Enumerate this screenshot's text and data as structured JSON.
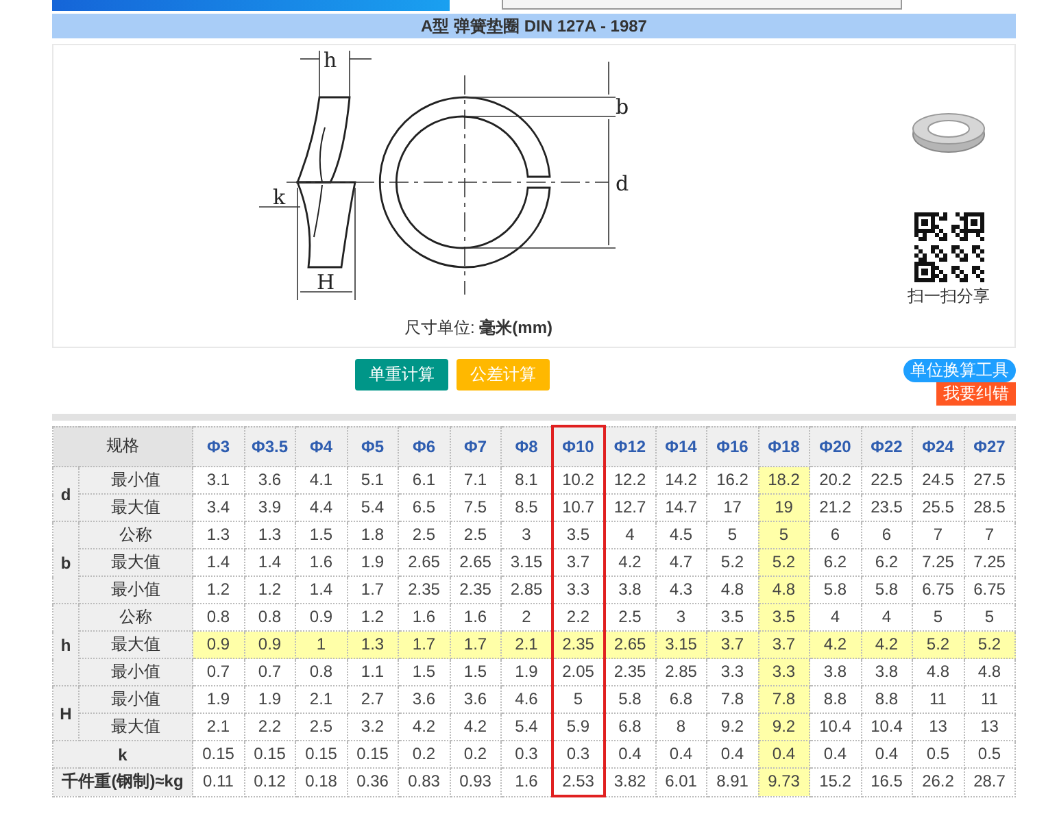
{
  "title": "A型 弹簧垫圈 DIN 127A - 1987",
  "drawing": {
    "labels": {
      "h": "h",
      "k": "k",
      "H": "H",
      "b": "b",
      "d": "d"
    },
    "unit_note": "尺寸单位: **毫米(mm)**",
    "share_label": "扫一扫分享"
  },
  "actions": [
    {
      "label": "单重计算",
      "color": "#009688"
    },
    {
      "label": "公差计算",
      "color": "#ffb800"
    }
  ],
  "side_actions": [
    {
      "label": "单位换算工具",
      "kind": "pill",
      "color": "#1e9fff"
    },
    {
      "label": "我要纠错",
      "kind": "tag",
      "color": "#ff5722"
    }
  ],
  "table": {
    "header_label": "规格",
    "columns": [
      {
        "label": "Φ3",
        "selected": false,
        "highlighted": false
      },
      {
        "label": "Φ3.5",
        "selected": false,
        "highlighted": false
      },
      {
        "label": "Φ4",
        "selected": false,
        "highlighted": false
      },
      {
        "label": "Φ5",
        "selected": false,
        "highlighted": false
      },
      {
        "label": "Φ6",
        "selected": false,
        "highlighted": false
      },
      {
        "label": "Φ7",
        "selected": false,
        "highlighted": false
      },
      {
        "label": "Φ8",
        "selected": false,
        "highlighted": false
      },
      {
        "label": "Φ10",
        "selected": true,
        "highlighted": false
      },
      {
        "label": "Φ12",
        "selected": false,
        "highlighted": false
      },
      {
        "label": "Φ14",
        "selected": false,
        "highlighted": false
      },
      {
        "label": "Φ16",
        "selected": false,
        "highlighted": false
      },
      {
        "label": "Φ18",
        "selected": false,
        "highlighted": true
      },
      {
        "label": "Φ20",
        "selected": false,
        "highlighted": false
      },
      {
        "label": "Φ22",
        "selected": false,
        "highlighted": false
      },
      {
        "label": "Φ24",
        "selected": false,
        "highlighted": false
      },
      {
        "label": "Φ27",
        "selected": false,
        "highlighted": false
      }
    ],
    "groups": [
      {
        "label": "d",
        "kind": "split",
        "rows": [
          {
            "label": "最小值",
            "highlighted": false,
            "values": [
              "3.1",
              "3.6",
              "4.1",
              "5.1",
              "6.1",
              "7.1",
              "8.1",
              "10.2",
              "12.2",
              "14.2",
              "16.2",
              "18.2",
              "20.2",
              "22.5",
              "24.5",
              "27.5"
            ]
          },
          {
            "label": "最大值",
            "highlighted": false,
            "values": [
              "3.4",
              "3.9",
              "4.4",
              "5.4",
              "6.5",
              "7.5",
              "8.5",
              "10.7",
              "12.7",
              "14.7",
              "17",
              "19",
              "21.2",
              "23.5",
              "25.5",
              "28.5"
            ]
          }
        ]
      },
      {
        "label": "b",
        "kind": "split",
        "rows": [
          {
            "label": "公称",
            "highlighted": false,
            "values": [
              "1.3",
              "1.3",
              "1.5",
              "1.8",
              "2.5",
              "2.5",
              "3",
              "3.5",
              "4",
              "4.5",
              "5",
              "5",
              "6",
              "6",
              "7",
              "7"
            ]
          },
          {
            "label": "最大值",
            "highlighted": false,
            "values": [
              "1.4",
              "1.4",
              "1.6",
              "1.9",
              "2.65",
              "2.65",
              "3.15",
              "3.7",
              "4.2",
              "4.7",
              "5.2",
              "5.2",
              "6.2",
              "6.2",
              "7.25",
              "7.25"
            ]
          },
          {
            "label": "最小值",
            "highlighted": false,
            "values": [
              "1.2",
              "1.2",
              "1.4",
              "1.7",
              "2.35",
              "2.35",
              "2.85",
              "3.3",
              "3.8",
              "4.3",
              "4.8",
              "4.8",
              "5.8",
              "5.8",
              "6.75",
              "6.75"
            ]
          }
        ]
      },
      {
        "label": "h",
        "kind": "split",
        "rows": [
          {
            "label": "公称",
            "highlighted": false,
            "values": [
              "0.8",
              "0.8",
              "0.9",
              "1.2",
              "1.6",
              "1.6",
              "2",
              "2.2",
              "2.5",
              "3",
              "3.5",
              "3.5",
              "4",
              "4",
              "5",
              "5"
            ]
          },
          {
            "label": "最大值",
            "highlighted": true,
            "values": [
              "0.9",
              "0.9",
              "1",
              "1.3",
              "1.7",
              "1.7",
              "2.1",
              "2.35",
              "2.65",
              "3.15",
              "3.7",
              "3.7",
              "4.2",
              "4.2",
              "5.2",
              "5.2"
            ]
          },
          {
            "label": "最小值",
            "highlighted": false,
            "values": [
              "0.7",
              "0.7",
              "0.8",
              "1.1",
              "1.5",
              "1.5",
              "1.9",
              "2.05",
              "2.35",
              "2.85",
              "3.3",
              "3.3",
              "3.8",
              "3.8",
              "4.8",
              "4.8"
            ]
          }
        ]
      },
      {
        "label": "H",
        "kind": "split",
        "rows": [
          {
            "label": "最小值",
            "highlighted": false,
            "values": [
              "1.9",
              "1.9",
              "2.1",
              "2.7",
              "3.6",
              "3.6",
              "4.6",
              "5",
              "5.8",
              "6.8",
              "7.8",
              "7.8",
              "8.8",
              "8.8",
              "11",
              "11"
            ]
          },
          {
            "label": "最大值",
            "highlighted": false,
            "values": [
              "2.1",
              "2.2",
              "2.5",
              "3.2",
              "4.2",
              "4.2",
              "5.4",
              "5.9",
              "6.8",
              "8",
              "9.2",
              "9.2",
              "10.4",
              "10.4",
              "13",
              "13"
            ]
          }
        ]
      },
      {
        "label": "k",
        "kind": "single",
        "rows": [
          {
            "highlighted": false,
            "values": [
              "0.15",
              "0.15",
              "0.15",
              "0.15",
              "0.2",
              "0.2",
              "0.3",
              "0.3",
              "0.4",
              "0.4",
              "0.4",
              "0.4",
              "0.4",
              "0.4",
              "0.5",
              "0.5"
            ]
          }
        ]
      },
      {
        "label": "千件重(钢制)≈kg",
        "kind": "single",
        "rows": [
          {
            "highlighted": false,
            "values": [
              "0.11",
              "0.12",
              "0.18",
              "0.36",
              "0.83",
              "0.93",
              "1.6",
              "2.53",
              "3.82",
              "6.01",
              "8.91",
              "9.73",
              "15.2",
              "16.5",
              "26.2",
              "28.7"
            ]
          }
        ]
      }
    ]
  }
}
